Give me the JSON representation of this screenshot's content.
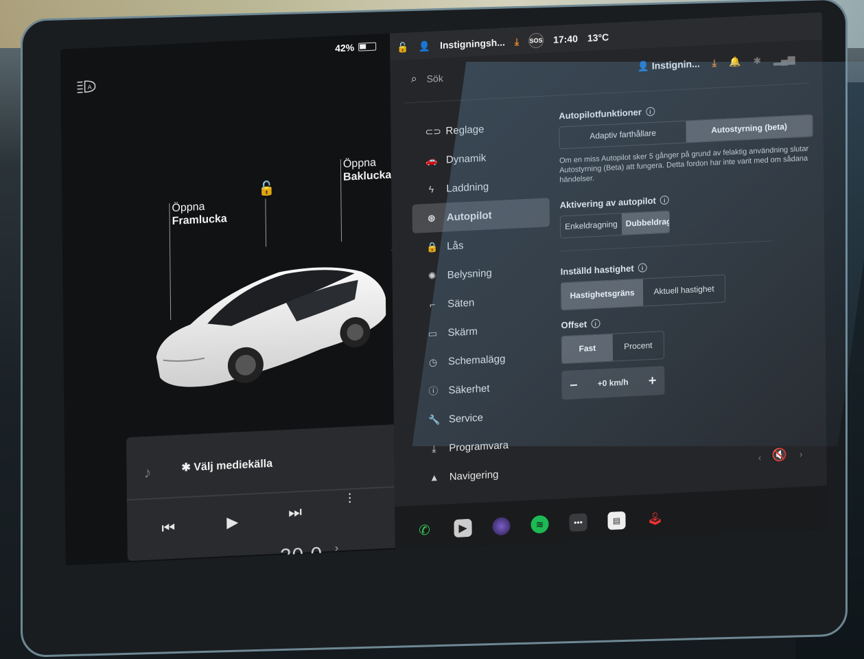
{
  "status": {
    "battery_text": "42%",
    "battery_level": 0.42,
    "profile_short": "Instigningsh...",
    "sos": "SOS",
    "time": "17:40",
    "outside_temp": "13°C"
  },
  "left": {
    "frunk_callout_line1": "Öppna",
    "frunk_callout_line2": "Framlucka",
    "trunk_callout_line1": "Öppna",
    "trunk_callout_line2": "Baklucka"
  },
  "media": {
    "title": "Välj mediekälla"
  },
  "climate": {
    "temperature": "20.0"
  },
  "settings": {
    "search_placeholder": "Sök",
    "profile_name": "Instignin...",
    "nav": [
      {
        "label": "Reglage",
        "icon": "toggle-icon"
      },
      {
        "label": "Dynamik",
        "icon": "car-icon"
      },
      {
        "label": "Laddning",
        "icon": "bolt-icon"
      },
      {
        "label": "Autopilot",
        "icon": "steering-wheel-icon",
        "active": true
      },
      {
        "label": "Lås",
        "icon": "lock-icon"
      },
      {
        "label": "Belysning",
        "icon": "sun-icon"
      },
      {
        "label": "Säten",
        "icon": "seat-icon"
      },
      {
        "label": "Skärm",
        "icon": "display-icon"
      },
      {
        "label": "Schemalägg",
        "icon": "clock-icon"
      },
      {
        "label": "Säkerhet",
        "icon": "info-icon"
      },
      {
        "label": "Service",
        "icon": "wrench-icon"
      },
      {
        "label": "Programvara",
        "icon": "download-icon"
      },
      {
        "label": "Navigering",
        "icon": "navigation-icon"
      }
    ],
    "autopilot": {
      "features_title": "Autopilotfunktioner",
      "feature_option_1": "Adaptiv farthållare",
      "feature_option_2": "Autostyrning (beta)",
      "features_note": "Om en miss Autopilot sker 5 gånger på grund av felaktig användning slutar Autostyrning (Beta) att fungera. Detta fordon har inte varit med om sådana händelser.",
      "activation_title": "Aktivering av autopilot",
      "activation_option_1": "Enkeldragning",
      "activation_option_2": "Dubbeldragning",
      "speed_title": "Inställd hastighet",
      "speed_option_1": "Hastighetsgräns",
      "speed_option_2": "Aktuell hastighet",
      "offset_title": "Offset",
      "offset_option_1": "Fast",
      "offset_option_2": "Procent",
      "offset_value": "+0 km/h",
      "minus": "–",
      "plus": "+"
    }
  },
  "colors": {
    "accent_orange": "#e8882a",
    "phone_green": "#34c759",
    "spotify_green": "#1db954"
  }
}
